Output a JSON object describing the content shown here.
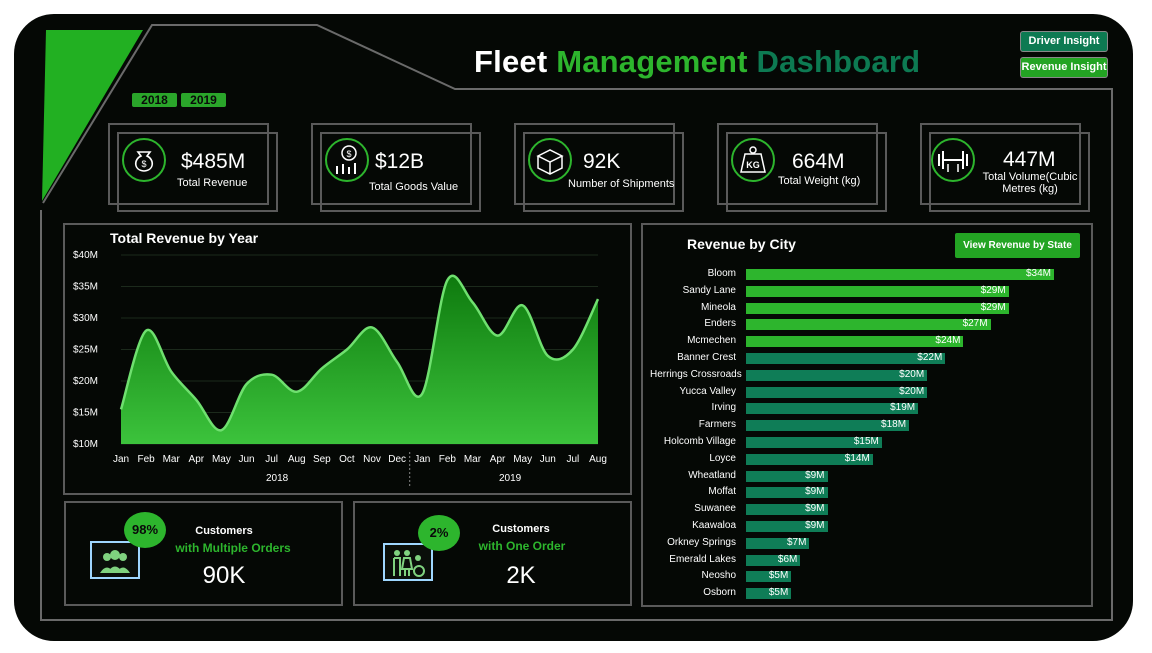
{
  "header": {
    "title_part1": "Fleet",
    "title_part2": "Management",
    "title_part3": "Dashboard",
    "driver_btn": "Driver Insight",
    "revenue_btn": "Revenue Insight"
  },
  "years": [
    "2018",
    "2019"
  ],
  "kpis": [
    {
      "value": "$485M",
      "label": "Total Revenue",
      "icon": "money-bag-icon"
    },
    {
      "value": "$12B",
      "label": "Total Goods Value",
      "icon": "dollar-growth-icon"
    },
    {
      "value": "92K",
      "label": "Number of Shipments",
      "icon": "boxes-icon"
    },
    {
      "value": "664M",
      "label": "Total Weight (kg)",
      "icon": "kg-weight-icon"
    },
    {
      "value": "447M",
      "label_line1": "Total Volume(Cubic",
      "label_line2": "Metres (kg)",
      "icon": "dumbbell-icon"
    }
  ],
  "revenue_chart_title": "Total Revenue by Year",
  "city_chart_title": "Revenue by City",
  "view_state_btn": "View Revenue by State",
  "customers": [
    {
      "percent": "98%",
      "heading": "Customers",
      "sub": "with Multiple Orders",
      "value": "90K",
      "icon": "group-icon"
    },
    {
      "percent": "2%",
      "heading": "Customers",
      "sub": "with One Order",
      "value": "2K",
      "icon": "family-icon"
    }
  ],
  "chart_data": [
    {
      "type": "area",
      "title": "Total Revenue by Year",
      "x": [
        "Jan",
        "Feb",
        "Mar",
        "Apr",
        "May",
        "Jun",
        "Jul",
        "Aug",
        "Sep",
        "Oct",
        "Nov",
        "Dec",
        "Jan",
        "Feb",
        "Mar",
        "Apr",
        "May",
        "Jun",
        "Jul",
        "Aug"
      ],
      "groups": [
        {
          "name": "2018",
          "count": 12
        },
        {
          "name": "2019",
          "count": 8
        }
      ],
      "values": [
        15.5,
        28.5,
        21,
        12,
        18.5,
        21,
        18,
        22.5,
        28.5,
        23,
        18,
        36,
        33,
        27,
        32,
        23,
        25,
        33
      ],
      "sample_points_note": "",
      "series": [
        {
          "values": [
            15.5,
            28,
            21.5,
            17,
            12.2,
            19.5,
            21,
            18.3,
            22,
            25,
            28.5,
            23,
            18,
            36,
            32.5,
            27.2,
            32,
            24,
            25,
            33
          ]
        }
      ],
      "ylim": [
        10,
        40
      ],
      "yticks": [
        "$10M",
        "$15M",
        "$20M",
        "$25M",
        "$30M",
        "$35M",
        "$40M"
      ],
      "grid": true
    },
    {
      "type": "bar",
      "title": "Revenue by City",
      "categories": [
        "Bloom",
        "Sandy Lane",
        "Mineola",
        "Enders",
        "Mcmechen",
        "Banner Crest",
        "Herrings Crossroads",
        "Yucca Valley",
        "Irving",
        "Farmers",
        "Holcomb Village",
        "Loyce",
        "Wheatland",
        "Moffat",
        "Suwanee",
        "Kaawaloa",
        "Orkney Springs",
        "Emerald Lakes",
        "Neosho",
        "Osborn"
      ],
      "values": [
        34,
        29,
        29,
        27,
        24,
        22,
        20,
        20,
        19,
        18,
        15,
        14,
        9,
        9,
        9,
        9,
        7,
        6,
        5,
        5
      ],
      "labels": [
        "$34M",
        "$29M",
        "$29M",
        "$27M",
        "$24M",
        "$22M",
        "$20M",
        "$20M",
        "$19M",
        "$18M",
        "$15M",
        "$14M",
        "$9M",
        "$9M",
        "$9M",
        "$9M",
        "$7M",
        "$6M",
        "$5M",
        "$5M"
      ],
      "colors": {
        "top5": "#2db52d",
        "rest": "#0f7d57"
      }
    }
  ]
}
